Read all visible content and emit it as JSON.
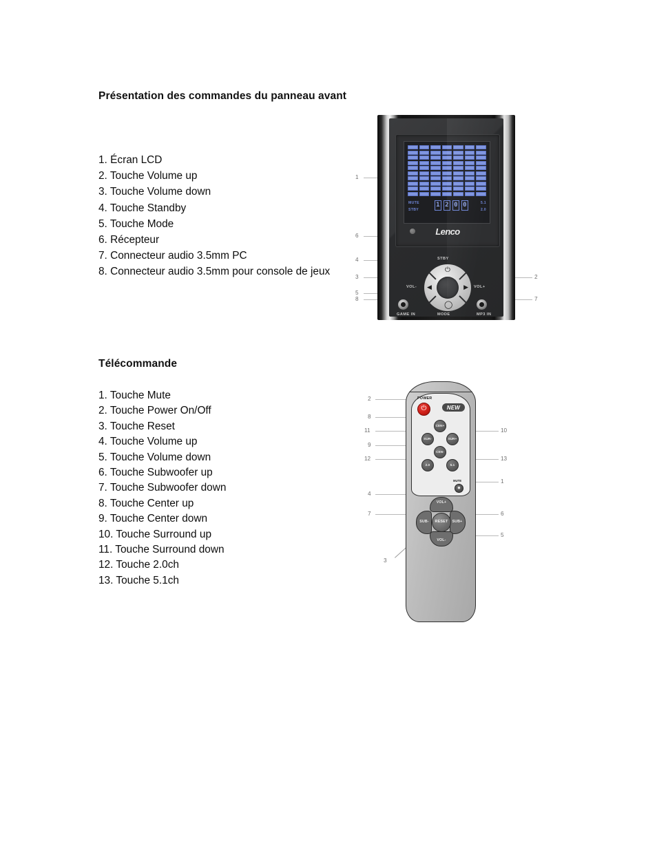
{
  "document": {
    "language": "fr",
    "sections": [
      {
        "id": "front-panel",
        "heading": "Présentation des commandes du panneau avant",
        "items": [
          "1. Écran LCD",
          "2. Touche Volume up",
          "3. Touche Volume down",
          "4. Touche Standby",
          "5. Touche Mode",
          "6. Récepteur",
          "7. Connecteur audio 3.5mm PC",
          "8. Connecteur audio 3.5mm pour console de jeux"
        ]
      },
      {
        "id": "remote-control",
        "heading": "Télécommande",
        "items": [
          "1. Touche Mute",
          "2. Touche Power On/Off",
          "3. Touche Reset",
          "4. Touche Volume up",
          "5. Touche Volume down",
          "6. Touche Subwoofer up",
          "7. Touche Subwoofer down",
          "8. Touche Center up",
          "9. Touche Center down",
          "10. Touche Surround up",
          "11. Touche Surround down",
          "12. Touche 2.0ch",
          "13. Touche 5.1ch"
        ]
      }
    ]
  },
  "front_panel_figure": {
    "brand_logo": "Lenco",
    "lcd": {
      "mute_label": "MUTE",
      "standby_label": "STBY",
      "mode_51": "5.1",
      "mode_20": "2.0",
      "digits": [
        "1",
        "2",
        "0",
        "0"
      ],
      "grid_columns": 7,
      "grid_rows": 10,
      "bar_color": "#7f95e0"
    },
    "controls": {
      "standby_label": "STBY",
      "power_icon": "⏻",
      "vol_down_label": "VOL-",
      "vol_down_icon": "◀",
      "vol_up_label": "VOL+",
      "vol_up_icon": "▶",
      "mode_label": "MODE",
      "mode_icon": "◯",
      "game_in_label": "GAME IN",
      "mp3_in_label": "MP3 IN"
    },
    "callouts_left": [
      "1",
      "6",
      "4",
      "3",
      "5",
      "8"
    ],
    "callouts_right": [
      "2",
      "7"
    ]
  },
  "remote_figure": {
    "power_label": "POWER",
    "power_icon": "⏻",
    "badge": "NEW",
    "buttons": {
      "center_up": "CEN+",
      "surround_down": "SUR-",
      "surround_up": "SUR+",
      "center_down": "CEN-",
      "ch_20": "2.0",
      "ch_51": "5.1",
      "mute_label": "MUTE",
      "mute_icon": "◼",
      "vol_up": "VOL+",
      "vol_down": "VOL-",
      "sub_down": "SUB-",
      "sub_up": "SUB+",
      "reset": "RESET"
    },
    "callouts_left": [
      "2",
      "8",
      "11",
      "9",
      "12",
      "4",
      "7",
      "3"
    ],
    "callouts_right": [
      "10",
      "13",
      "1",
      "6",
      "5"
    ]
  }
}
